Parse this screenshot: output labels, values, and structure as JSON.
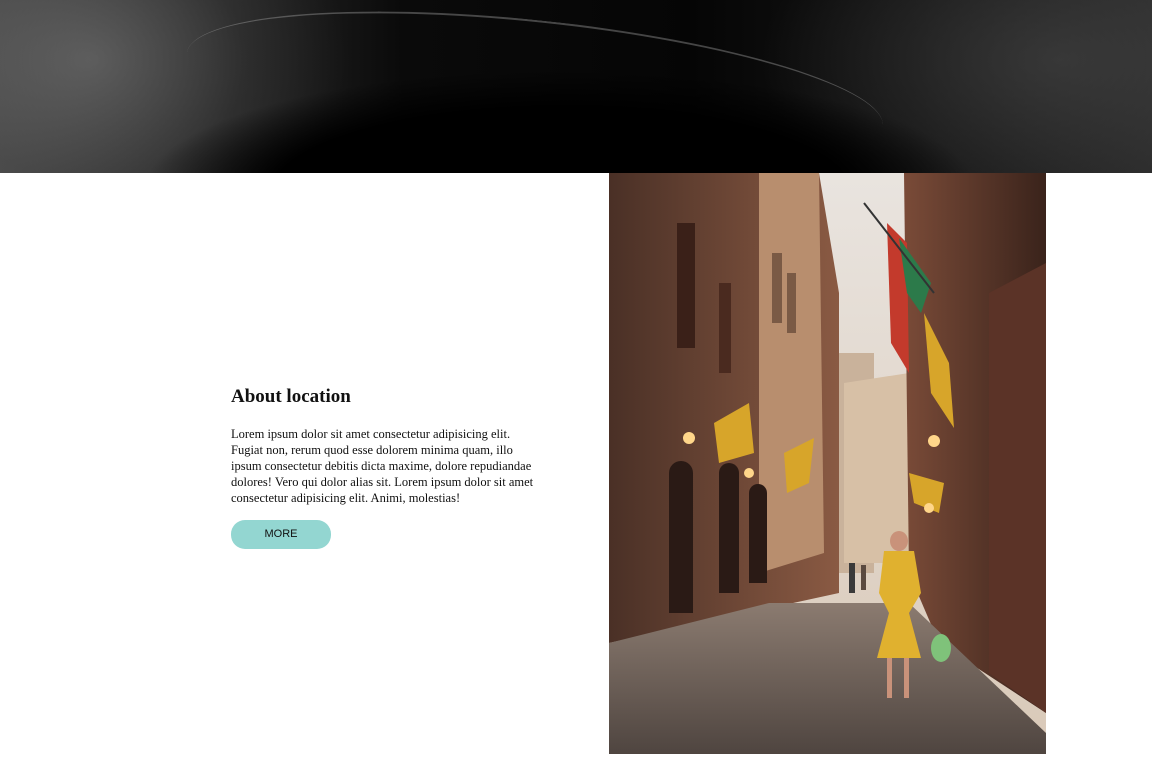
{
  "hero": {
    "icon": "abstract-dark-banner"
  },
  "about": {
    "title": "About location",
    "body": "Lorem ipsum dolor sit amet consectetur adipisicing elit. Fugiat non, rerum quod esse dolorem minima quam, illo ipsum consectetur debitis dicta maxime, dolore repudiandae dolores! Vero qui dolor alias sit. Lorem ipsum dolor sit amet consectetur adipisicing elit. Animi, molestias!",
    "more_label": "MORE"
  },
  "photo": {
    "icon": "street-photo"
  },
  "colors": {
    "button": "#93d6d1",
    "text": "#111111"
  }
}
